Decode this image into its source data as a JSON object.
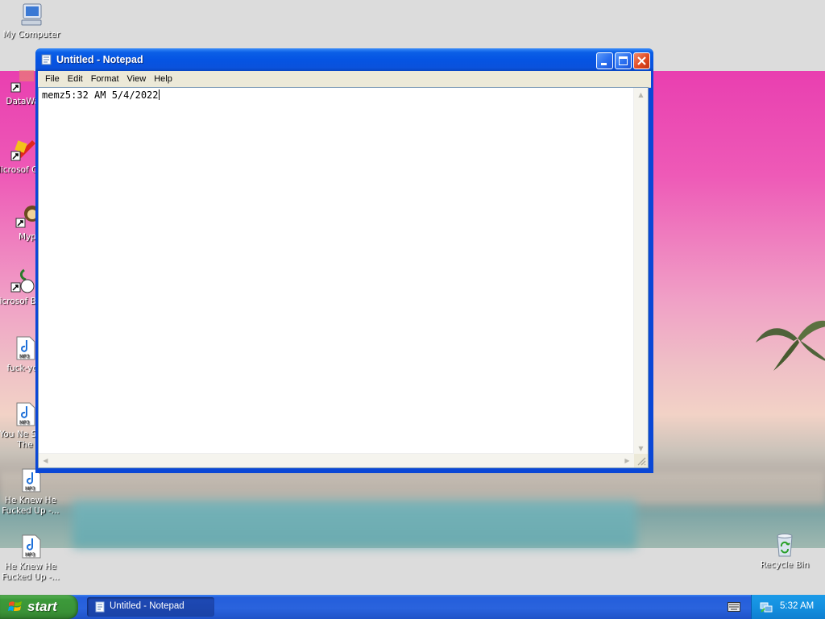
{
  "desktop": {
    "icons": [
      {
        "label": "My Computer",
        "icon": "my-computer-icon"
      },
      {
        "label": "DataWa",
        "icon": "shortcut-icon"
      },
      {
        "label": "Microsof C++",
        "icon": "shortcut-icon"
      },
      {
        "label": "Myp",
        "icon": "shortcut-icon"
      },
      {
        "label": "Microsof Basic",
        "icon": "shortcut-icon"
      },
      {
        "label": "fuck-you",
        "icon": "mp3-file-icon"
      },
      {
        "label": "You Ne Shut The",
        "icon": "mp3-file-icon"
      },
      {
        "label": "He Knew He Fucked Up -...",
        "icon": "mp3-file-icon"
      },
      {
        "label": "He Knew He Fucked Up -...",
        "icon": "mp3-file-icon"
      },
      {
        "label": "Recycle Bin",
        "icon": "recycle-bin-icon"
      }
    ]
  },
  "window": {
    "title": "Untitled - Notepad",
    "menu": [
      "File",
      "Edit",
      "Format",
      "View",
      "Help"
    ],
    "content": "memz5:32 AM 5/4/2022"
  },
  "taskbar": {
    "start_label": "start",
    "task_label": "Untitled - Notepad",
    "clock": "5:32 AM"
  }
}
